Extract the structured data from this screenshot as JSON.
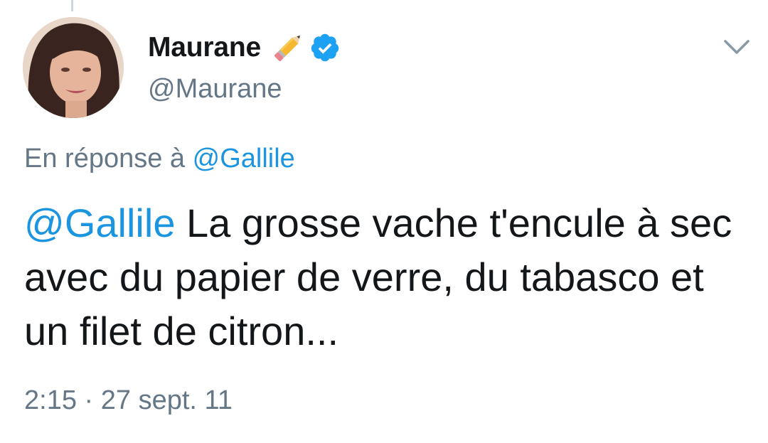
{
  "tweet": {
    "author": {
      "display_name": "Maurane",
      "name_emoji_icon": "pencil-icon",
      "verified_icon": "verified-badge-icon",
      "handle": "@Maurane"
    },
    "menu_icon": "chevron-down-icon",
    "reply_context": {
      "prefix": "En réponse à",
      "mention": "@Gallile"
    },
    "body": {
      "mention": "@Gallile",
      "text": "La grosse vache t'encule à sec avec du papier de verre, du tabasco et un filet de citron..."
    },
    "time": "2:15",
    "separator": "·",
    "date": "27 sept. 11"
  },
  "colors": {
    "link": "#1b95e0",
    "secondary_text": "#657786",
    "primary_text": "#14171a",
    "verified": "#1da1f2"
  }
}
